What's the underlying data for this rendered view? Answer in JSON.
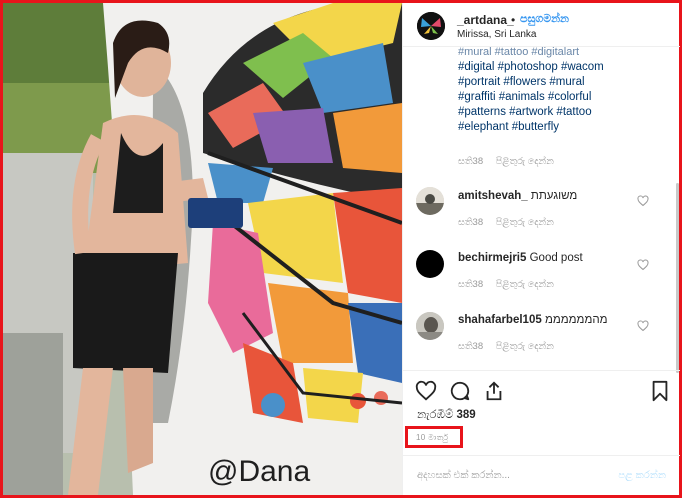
{
  "post": {
    "username": "_artdana_",
    "dot": "•",
    "follow_label": "පසුගමන්න",
    "location": "Mirissa, Sri Lanka"
  },
  "caption": {
    "partial_top": "#mural #tattoo #digitalart",
    "lines": [
      "#digital #photoshop #wacom",
      "#portrait #flowers #mural",
      "#graffiti #animals #colorful",
      "#patterns #artwork #tattoo",
      "#elephant #butterfly"
    ],
    "age": "සති38",
    "reply": "පිළිතුරු දෙන්න"
  },
  "comments": [
    {
      "username": "amitshevah_",
      "text": "משוגעתת",
      "age": "සති38",
      "reply": "පිළිතුරු දෙන්න"
    },
    {
      "username": "bechirmejri5",
      "text": "Good post",
      "age": "සති38",
      "reply": "පිළිතුරු දෙන්න"
    },
    {
      "username": "shahafarbel105",
      "text": "מהממממממ",
      "age": "සති38",
      "reply": "පිළිතුරු දෙන්න"
    }
  ],
  "stats": {
    "likes_label": "නැරඹීම්",
    "likes_count": "389",
    "date": "10 මාර්තු"
  },
  "composer": {
    "placeholder": "අදහසක් එක් කරන්න...",
    "post_label": "පළ කරන්න"
  },
  "media": {
    "wall_signature": "@Dana"
  },
  "colors": {
    "accent": "#3897f0",
    "highlight_border": "#e8141b",
    "tag": "#003569"
  }
}
